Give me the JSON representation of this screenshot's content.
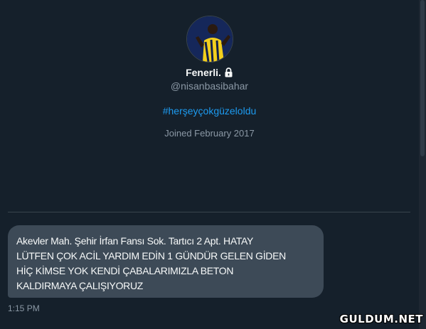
{
  "profile": {
    "display_name": "Fenerli.",
    "handle": "@nisanbasibahar",
    "bio_hashtag": "#herşeyçokgüzeloldu",
    "joined": "Joined February 2017",
    "avatar_icon": "profile-photo",
    "lock_icon": "lock-icon"
  },
  "message": {
    "lines": [
      "Akevler Mah. Şehir İrfan Fansı Sok. Tartıcı 2 Apt. HATAY",
      "LÜTFEN ÇOK ACİL YARDIM EDİN 1 GÜNDÜR GELEN GİDEN",
      "HİÇ KİMSE YOK KENDİ ÇABALARIMIZLA BETON",
      "KALDIRMAYA ÇALIŞIYORUZ"
    ],
    "time": "1:15 PM"
  },
  "watermark": "GULDUM.NET",
  "colors": {
    "background": "#15202b",
    "bubble": "#3d4a57",
    "accent": "#1d9bf0",
    "muted": "#8b98a5"
  }
}
